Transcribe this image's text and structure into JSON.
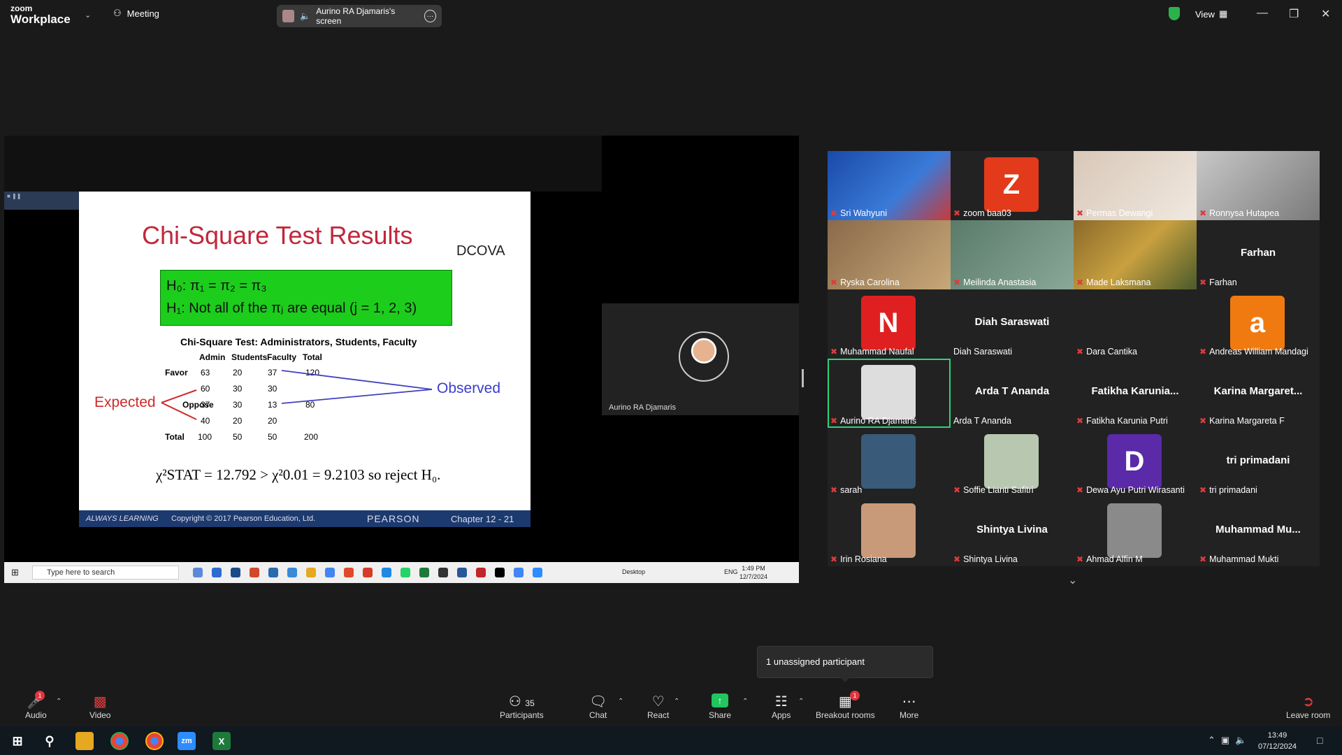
{
  "app": {
    "brand_top": "zoom",
    "brand_bottom": "Workplace",
    "meeting_label": "Meeting",
    "screen_label": "Aurino RA Djamaris's screen",
    "view_label": "View"
  },
  "slide": {
    "title": "Chi-Square Test Results",
    "tag": "DCOVA",
    "h0": "H₀: π₁ = π₂ = π₃",
    "h1": "H₁: Not all of the πⱼ are equal (j = 1, 2, 3)",
    "table_title": "Chi-Square Test: Administrators, Students, Faculty",
    "headers": [
      "Admin",
      "Students",
      "Faculty",
      "Total"
    ],
    "row_favor_label": "Favor",
    "row_oppose_label": "Oppose",
    "row_total_label": "Total",
    "favor_obs": [
      "63",
      "20",
      "37",
      "120"
    ],
    "favor_exp": [
      "60",
      "30",
      "30"
    ],
    "oppose_obs": [
      "37",
      "30",
      "13",
      "80"
    ],
    "oppose_exp": [
      "40",
      "20",
      "20"
    ],
    "totals": [
      "100",
      "50",
      "50",
      "200"
    ],
    "expected_label": "Expected",
    "observed_label": "Observed",
    "formula": "χ²STAT = 12.792 > χ²0.01 = 9.2103  so reject H₀.",
    "footer_left": "ALWAYS LEARNING",
    "footer_copy": "Copyright © 2017 Pearson Education, Ltd.",
    "footer_brand": "PEARSON",
    "footer_chapter": "Chapter 12 - 21"
  },
  "presenter_name": "Aurino RA Djamaris",
  "inner_taskbar": {
    "search_placeholder": "Type here to search",
    "desktop_label": "Desktop",
    "lang": "ENG",
    "time": "1:49 PM",
    "date": "12/7/2024"
  },
  "participants": [
    {
      "name": "Sri Wahyuni"
    },
    {
      "name": "zoom baa03",
      "initial": "Z"
    },
    {
      "name": "Permas Dewangi"
    },
    {
      "name": "Ronnysa Hutapea"
    },
    {
      "name": "Ryska Carolina"
    },
    {
      "name": "Meilinda Anastasia"
    },
    {
      "name": "Made Laksmana"
    },
    {
      "name": "Farhan",
      "big": "Farhan"
    },
    {
      "name": "Muhammad Naufal",
      "initial": "N"
    },
    {
      "name": "Diah Saraswati",
      "big": "Diah Saraswati"
    },
    {
      "name": "Dara Cantika"
    },
    {
      "name": "Andreas William Mandagi",
      "initial": "a"
    },
    {
      "name": "Aurino RA Djamaris"
    },
    {
      "name": "Arda T Ananda",
      "big": "Arda T Ananda"
    },
    {
      "name": "Fatikha Karunia Putri",
      "big": "Fatikha  Karunia..."
    },
    {
      "name": "Karina Margareta F",
      "big": "Karina  Margaret..."
    },
    {
      "name": "sarah"
    },
    {
      "name": "Soffie Lianti Safitri"
    },
    {
      "name": "Dewa Ayu Putri Wirasanti",
      "initial": "D"
    },
    {
      "name": "tri primadani",
      "big": "tri primadani"
    },
    {
      "name": "Irin Rosiana"
    },
    {
      "name": "Shintya Livina",
      "big": "Shintya Livina"
    },
    {
      "name": "Ahmad Alfin M"
    },
    {
      "name": "Muhammad Mukti",
      "big": "Muhammad  Mu..."
    }
  ],
  "tooltip": "1 unassigned participant",
  "toolbar": {
    "audio": "Audio",
    "video": "Video",
    "participants": "Participants",
    "participants_count": "35",
    "chat": "Chat",
    "react": "React",
    "share": "Share",
    "apps": "Apps",
    "breakout": "Breakout rooms",
    "breakout_badge": "1",
    "more": "More",
    "leave": "Leave room",
    "audio_badge": "1"
  },
  "os_taskbar": {
    "time": "13:49",
    "date": "07/12/2024"
  },
  "colors": {
    "accent_green": "#2ed477",
    "slide_title": "#c2273a",
    "share_green": "#22c55e"
  }
}
